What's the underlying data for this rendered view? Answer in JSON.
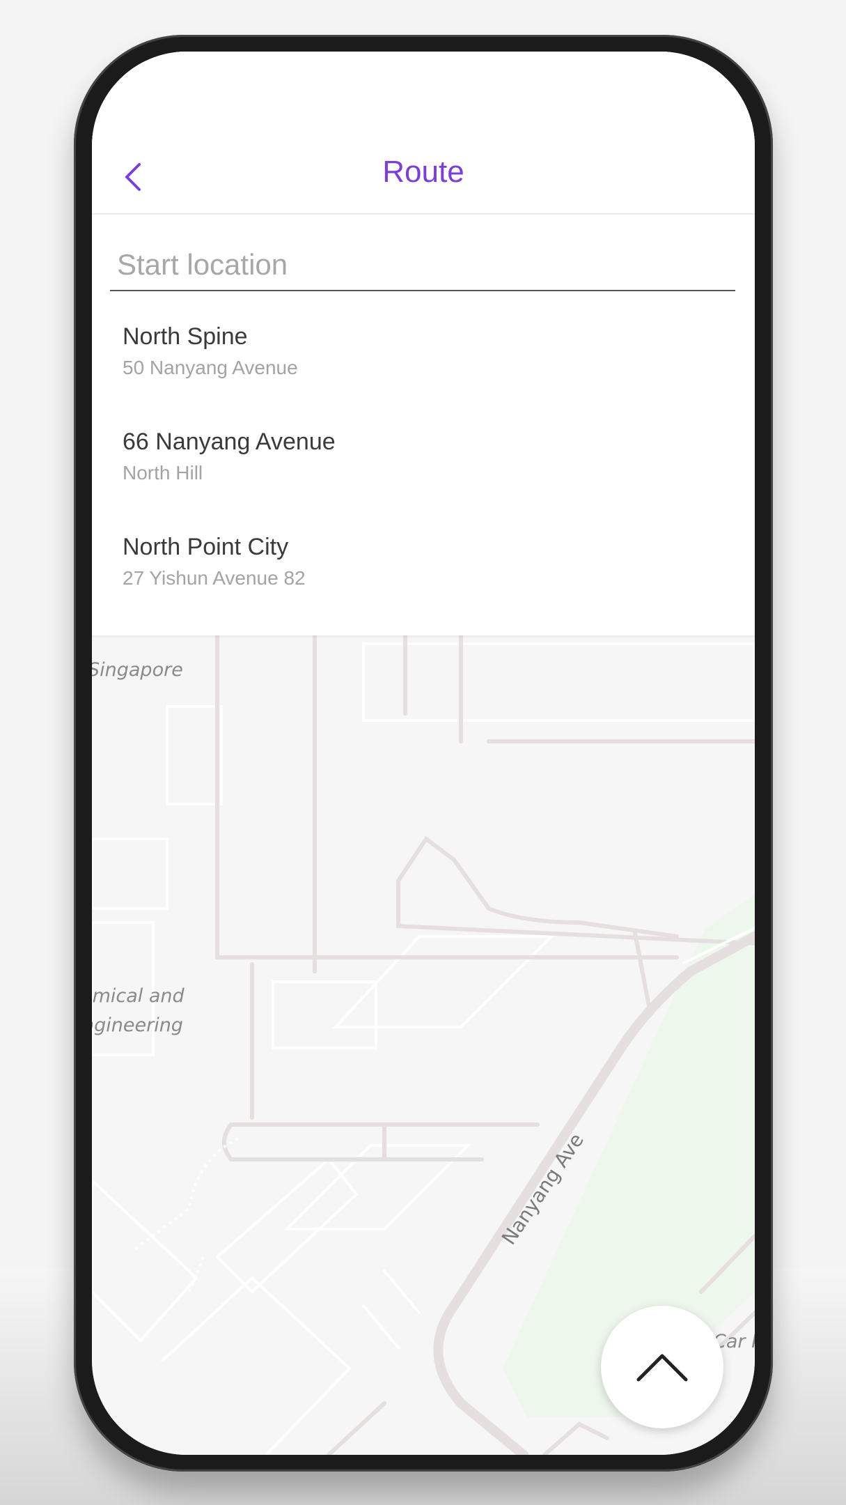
{
  "header": {
    "title": "Route",
    "back_icon": "chevron-left-icon",
    "accent_color": "#7b3fd8"
  },
  "search": {
    "placeholder": "Start location",
    "value": ""
  },
  "suggestions": [
    {
      "name": "North Spine",
      "address": "50 Nanyang Avenue"
    },
    {
      "name": "66 Nanyang Avenue",
      "address": "North Hill"
    },
    {
      "name": "North Point City",
      "address": "27 Yishun Avenue 82"
    }
  ],
  "map": {
    "labels": {
      "top_partial": "Singapore",
      "building_line1": "emical and",
      "building_line2": "ngineering",
      "road": "Nanyang Ave",
      "bottom_right_partial": "Car P"
    },
    "park_color": "#eef7ec",
    "road_color": "#e6dfdf"
  },
  "fab": {
    "icon": "chevron-up-icon"
  }
}
